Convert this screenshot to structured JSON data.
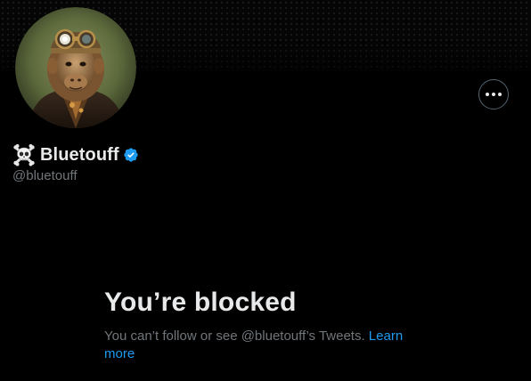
{
  "profile": {
    "display_name": "Bluetouff",
    "handle": "@bluetouff",
    "name_emoji_icon": "skull-and-crossbones-icon",
    "verified_icon": "verified-badge-icon",
    "avatar_alt": "profile-avatar"
  },
  "actions": {
    "more_icon": "more-horizontal-icon"
  },
  "blocked": {
    "title": "You’re blocked",
    "message": "You can’t follow or see @bluetouff’s Tweets.",
    "link_label": "Learn more"
  },
  "colors": {
    "background": "#000000",
    "primary_text": "#e7e9ea",
    "secondary_text": "#71767b",
    "link": "#1d9bf0",
    "verified_badge": "#1d9bf0",
    "button_border": "#536471"
  }
}
